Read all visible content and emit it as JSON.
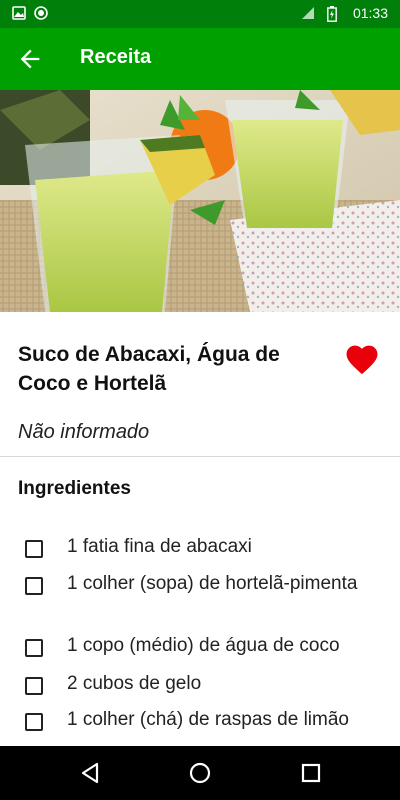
{
  "status_bar": {
    "time": "01:33",
    "icons": [
      "image-icon",
      "circle-badge-icon",
      "signal-icon",
      "battery-icon"
    ]
  },
  "app_bar": {
    "title": "Receita",
    "back_icon": "arrow-left-icon"
  },
  "hero": {
    "image": "pineapple-drink-photo"
  },
  "recipe": {
    "title": "Suco de Abacaxi, Água de Coco e Hortelã",
    "favorite_icon": "heart-icon",
    "favorite_color": "#e8000a",
    "subtitle": "Não informado"
  },
  "ingredients": {
    "heading": "Ingredientes",
    "items": [
      {
        "label": "1 fatia fina de abacaxi",
        "checked": false
      },
      {
        "label": "1 colher (sopa) de hortelã-pimenta",
        "checked": false
      },
      {
        "label": "1 copo (médio) de água de coco",
        "checked": false
      },
      {
        "label": "2 cubos de gelo",
        "checked": false
      },
      {
        "label": "1 colher (chá) de raspas de limão",
        "checked": false
      }
    ]
  },
  "nav_bar": {
    "buttons": [
      "back-triangle-icon",
      "home-circle-icon",
      "recents-square-icon"
    ]
  },
  "colors": {
    "status_bar": "#00800a",
    "app_bar": "#00a000"
  }
}
